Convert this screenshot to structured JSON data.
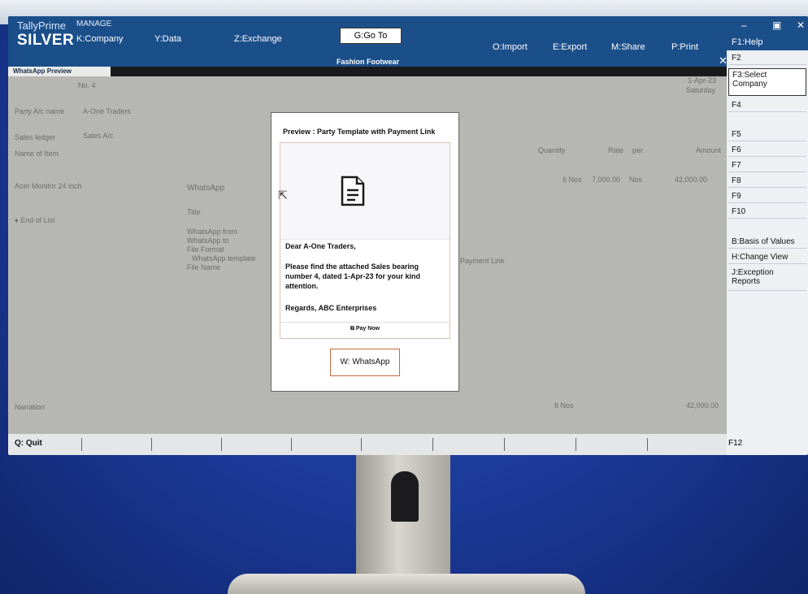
{
  "app": {
    "product": "TallyPrime",
    "edition": "SILVER",
    "manage_label": "MANAGE"
  },
  "menu": {
    "company": "K:Company",
    "data": "Y:Data",
    "exchange": "Z:Exchange"
  },
  "goto": "G:Go To",
  "subtitle": "Fashion Footwear",
  "window_label": "WhatsApp Preview",
  "toolbar": {
    "import": "O:Import",
    "export": "E:Export",
    "share": "M:Share",
    "print": "P:Print",
    "help": "F1:Help"
  },
  "right_panel": {
    "f2": "F2",
    "f3": "F3:Select Company",
    "f4": "F4",
    "f5": "F5",
    "f6": "F6",
    "f7": "F7",
    "f8": "F8",
    "f9": "F9",
    "f10": "F10",
    "basis": "B:Basis of Values",
    "change_view": "H:Change View",
    "exception": "J:Exception Reports",
    "f12": "F12"
  },
  "voucher": {
    "no": "No.   4",
    "date": "1-Apr-23",
    "day": "Saturday",
    "party_label": "Party A/c name",
    "party": "A-One Traders",
    "sales_ledger_label": "Sales ledger",
    "sales_ledger": "Sales A/c",
    "item_header": "Name of Item",
    "qty_header": "Quantity",
    "rate_header": "Rate",
    "per_header": "per",
    "amount_header": "Amount",
    "item": "Acer Monitor 24 inch",
    "qty": "6 Nos",
    "rate": "7,000.00",
    "per": "Nos",
    "amount": "42,000.00",
    "end_of_list": "♦ End of List",
    "narration_label": "Narration",
    "total_qty": "6 Nos",
    "total_amount": "42,000.00"
  },
  "bg_form": {
    "whatsapp": "WhatsApp",
    "title": "Title",
    "from": "WhatsApp from",
    "to": "WhatsApp to",
    "file_format": "File Format",
    "template": "WhatsApp template",
    "file_name": "File Name",
    "payment_link": "Payment Link"
  },
  "dialog": {
    "title": "Preview :  Party Template with Payment Link",
    "greeting": "Dear A-One Traders,",
    "body": "Please find the attached Sales bearing number 4, dated 1-Apr-23 for your kind attention.",
    "signoff": "Regards, ABC Enterprises",
    "pay_now": "Pay Now",
    "whatsapp_button": "W: WhatsApp"
  },
  "bottom": {
    "quit": "Q: Quit"
  },
  "colors": {
    "header": "#1b4f8a",
    "wall": "#1c3c9a",
    "button_border": "#c46c3c"
  }
}
